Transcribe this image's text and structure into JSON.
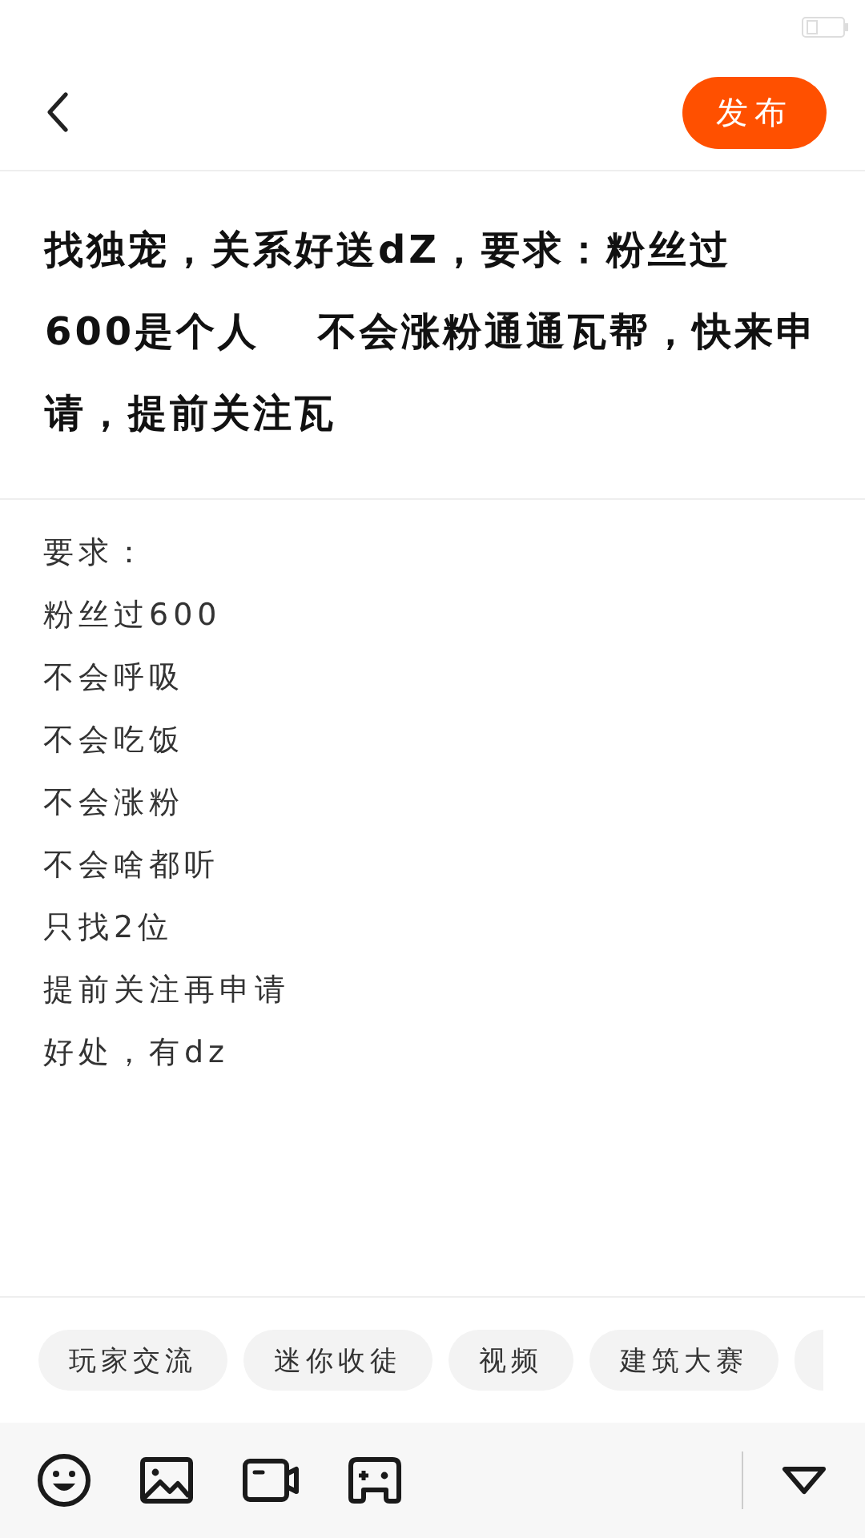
{
  "header": {
    "publish_button": "发布"
  },
  "post": {
    "title": "找独宠，关系好送dZ，要求：粉丝过600是个人　 不会涨粉通通瓦帮，快来申请，提前关注瓦",
    "body_lines": [
      "要求：",
      "粉丝过600",
      "不会呼吸",
      "不会吃饭",
      "不会涨粉",
      "不会啥都听",
      "只找2位",
      "提前关注再申请",
      "好处，有dz"
    ]
  },
  "tags": [
    "玩家交流",
    "迷你收徒",
    "视频",
    "建筑大赛"
  ]
}
